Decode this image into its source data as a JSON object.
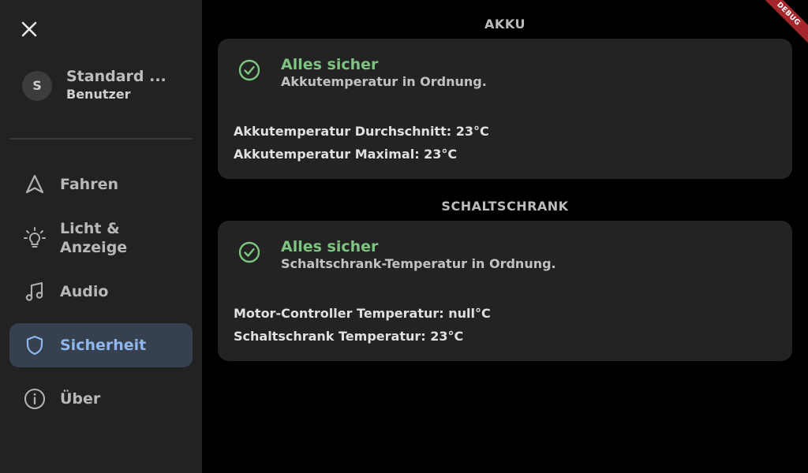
{
  "sidebar": {
    "close_icon": "close-icon",
    "profile": {
      "initial": "S",
      "name": "Standard ...",
      "role": "Benutzer"
    },
    "items": [
      {
        "label": "Fahren",
        "icon": "navigation-arrow-icon"
      },
      {
        "label": "Licht & Anzeige",
        "icon": "lightbulb-icon"
      },
      {
        "label": "Audio",
        "icon": "music-note-icon"
      },
      {
        "label": "Sicherheit",
        "icon": "shield-icon",
        "active": true
      },
      {
        "label": "Über",
        "icon": "info-icon"
      }
    ]
  },
  "main": {
    "sections": [
      {
        "title": "AKKU",
        "status_title": "Alles sicher",
        "status_sub": "Akkutemperatur in Ordnung.",
        "details": [
          "Akkutemperatur Durchschnitt: 23°C",
          "Akkutemperatur Maximal: 23°C"
        ]
      },
      {
        "title": "SCHALTSCHRANK",
        "status_title": "Alles sicher",
        "status_sub": "Schaltschrank-Temperatur in Ordnung.",
        "details": [
          "Motor-Controller Temperatur: null°C",
          "Schaltschrank Temperatur: 23°C"
        ]
      }
    ]
  },
  "debug_banner": "DEBUG",
  "colors": {
    "sidebar_bg": "#222222",
    "active_bg": "#36404f",
    "active_text": "#8fb6ee",
    "ok_green": "#7cc47f",
    "card_bg": "#232323",
    "debug_red": "#a5262b"
  }
}
